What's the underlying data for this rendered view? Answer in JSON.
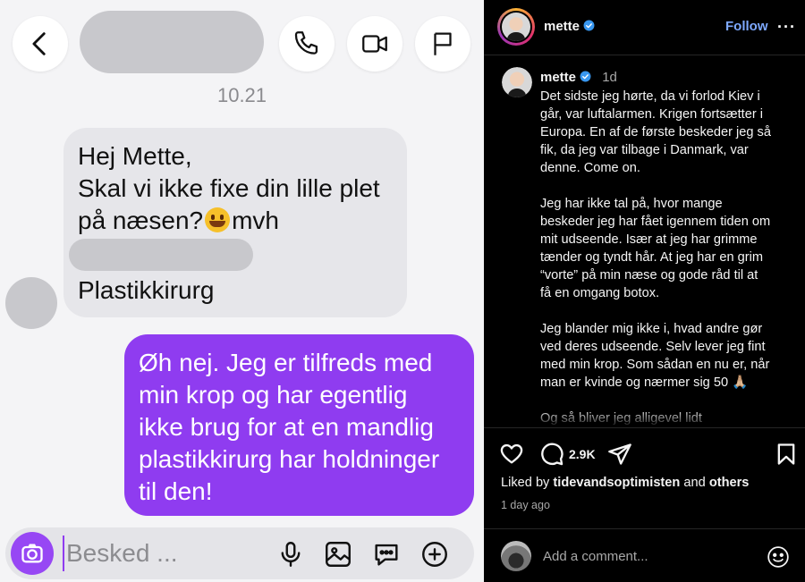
{
  "chat": {
    "timestamp": "10.21",
    "incoming_lines": [
      "Hej Mette,",
      "Skal vi ikke fixe din lille plet",
      "på næsen?",
      "mvh",
      "Plastikkirurg"
    ],
    "outgoing_lines": [
      "Øh nej. Jeg er tilfreds med",
      "min krop og har egentlig",
      "ikke brug for at en mandlig",
      "plastikkirurg har holdninger",
      "til den!"
    ],
    "composer_placeholder": "Besked ...",
    "colors": {
      "outgoing_bubble": "#8f3cf0",
      "incoming_bubble": "#e6e6ea",
      "background": "#f4f4f6"
    },
    "icons": [
      "back-icon",
      "phone-icon",
      "video-icon",
      "flag-icon",
      "camera-icon",
      "mic-icon",
      "gallery-icon",
      "sticker-icon",
      "plus-icon"
    ]
  },
  "post": {
    "username": "mette",
    "follow_label": "Follow",
    "more_label": "···",
    "age_short": "1d",
    "caption_lines": [
      "Det sidste jeg hørte, da vi forlod Kiev i",
      "går, var luftalarmen. Krigen fortsætter i",
      "Europa. En af de første beskeder jeg så",
      "fik, da jeg var tilbage i Danmark, var",
      "denne. Come on.",
      "",
      "Jeg har ikke tal på, hvor mange",
      "beskeder jeg har fået igennem tiden om",
      "mit udseende. Især at jeg har grimme",
      "tænder og tyndt hår. At jeg har en grim",
      "“vorte” på min næse og gode råd til at",
      "få en omgang botox.",
      "",
      "Jeg blander mig ikke i, hvad andre gør",
      "ved deres udseende. Selv lever jeg fint",
      "med min krop. Som sådan en nu er, når",
      "man er kvinde og nærmer sig 50 🙏🏼",
      "",
      "Og så bliver jeg alligevel lidt"
    ],
    "comment_count": "2.9K",
    "liked_by_prefix": "Liked by",
    "liked_by_user": "tidevandsoptimisten",
    "liked_by_and": "and",
    "liked_by_others": "others",
    "age_long": "1 day ago",
    "comment_placeholder": "Add a comment...",
    "colors": {
      "background": "#000000",
      "follow": "#7ea9ff",
      "verified": "#3897f0",
      "muted": "#a8a8a8"
    },
    "icons": [
      "verified-badge-icon",
      "heart-icon",
      "comment-icon",
      "share-icon",
      "bookmark-icon",
      "emoji-icon"
    ]
  }
}
